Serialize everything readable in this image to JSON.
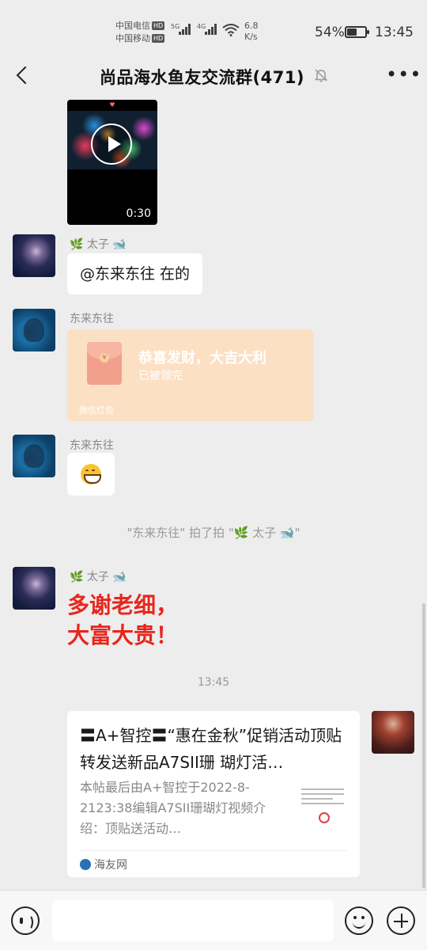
{
  "status_bar": {
    "carrier1": "中国电信",
    "carrier2": "中国移动",
    "hd": "HD",
    "net1": "5G",
    "net2": "4G",
    "speed_value": "6.8",
    "speed_unit": "K/s",
    "battery": "54%",
    "battery_level": 0.54,
    "time": "13:45"
  },
  "header": {
    "title": "尚品海水鱼友交流群(471)"
  },
  "messages": {
    "video_duration": "0:30",
    "sender_taizi": "太子",
    "reply_text": "@东来东往  在的",
    "sender_dong": "东来东往",
    "redpacket_greeting": "恭喜发财，大吉大利",
    "redpacket_status": "已被领完",
    "redpacket_footer": "微信红包",
    "sender_dong2": "东来东往",
    "pat_text": "\"东来东往\" 拍了拍 \"🌿 太子 🐋\"",
    "sender_taizi2": "太子",
    "big_line1": "多谢老细，",
    "big_line2": "大富大贵！",
    "time_divider": "13:45",
    "card_title": "〓A+智控〓“惠在金秋”促销活动顶贴转发送新品A7SII珊 瑚灯活…",
    "card_desc": "本帖最后由A+智控于2022-8-2123:38编辑A7SII珊瑚灯视频介绍：顶贴送活动…",
    "card_source": "海友网"
  },
  "icons": {
    "leaf": "🌿",
    "whale": "🐋"
  },
  "colors": {
    "redpacket_bg": "#fce0c4",
    "big_text": "#e8261e"
  }
}
